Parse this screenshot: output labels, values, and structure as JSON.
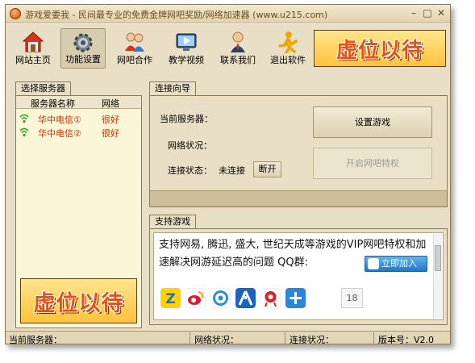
{
  "window": {
    "title": "游戏爱要我 - 民间最专业的免费金牌网吧奖励/网络加速器 (www.u215.com)",
    "min_symbol": "–",
    "max_symbol": "□",
    "close_symbol": "✕"
  },
  "toolbar": {
    "items": [
      {
        "label": "网站主页",
        "icon": "home-icon"
      },
      {
        "label": "功能设置",
        "icon": "gear-icon"
      },
      {
        "label": "网吧合作",
        "icon": "users-icon"
      },
      {
        "label": "教学视频",
        "icon": "video-icon"
      },
      {
        "label": "联系我们",
        "icon": "contact-icon"
      },
      {
        "label": "退出软件",
        "icon": "exit-icon"
      }
    ],
    "banner_text": "虚位以待"
  },
  "server_panel": {
    "tab_label": "选择服务器",
    "col_name": "服务器名称",
    "col_net": "网络",
    "rows": [
      {
        "name": "华中电信①",
        "net": "很好"
      },
      {
        "name": "华中电信②",
        "net": "很好"
      }
    ],
    "banner_text": "虚位以待"
  },
  "connect_panel": {
    "tab_label": "连接向导",
    "current_server_label": "当前服务器：",
    "network_label": "网络状况：",
    "connect_state_label": "连接状态：",
    "connect_state_value": "未连接",
    "disconnect_label": "断开",
    "setup_game_label": "设置游戏",
    "open_privilege_label": "开启网吧特权"
  },
  "games_panel": {
    "tab_label": "支持游戏",
    "text": "支持网易, 腾迅, 盛大, 世纪天成等游戏的VIP网吧特权和加速解决网游延迟高的问题 QQ群:",
    "join_label": "立即加入",
    "icons": [
      "qzone-icon",
      "weibo-icon",
      "tencent-weibo-icon",
      "renren-icon",
      "netease-icon",
      "plus-icon"
    ],
    "count": "18"
  },
  "status_bar": {
    "current_server": "当前服务器：",
    "network": "网络状况：",
    "connect": "连接状况：",
    "version": "版本号：V2.0"
  },
  "colors": {
    "window_bg": "#e9dfc7",
    "list_bg": "#fbf6d6",
    "server_text": "#c4320e",
    "banner_text": "#e5510e",
    "join_button": "#1f78c6"
  }
}
